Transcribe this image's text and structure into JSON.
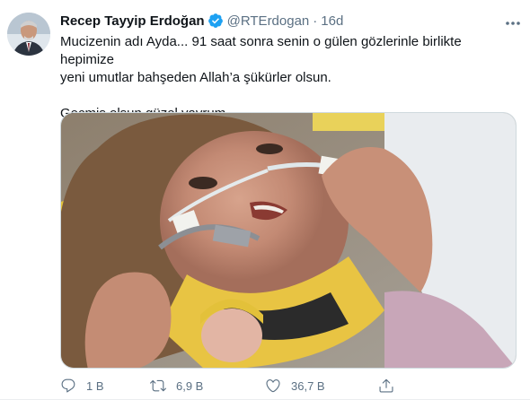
{
  "tweet": {
    "display_name": "Recep Tayyip Erdoğan",
    "handle": "@RTErdogan",
    "separator": "·",
    "time": "16d",
    "text_line1": "Mucizenin adı Ayda... 91 saat sonra senin o gülen gözlerinle birlikte hepimize",
    "text_line2": "yeni umutlar bahşeden Allah’a şükürler olsun.",
    "text_line3": "Geçmiş olsun güzel yavrum...",
    "icons": {
      "avatar": "profile-photo",
      "verified": "verified-badge-icon",
      "more": "more-options-icon",
      "reply": "reply-icon",
      "retweet": "retweet-icon",
      "like": "heart-icon",
      "share": "share-icon"
    },
    "colors": {
      "verified": "#1da1f2",
      "secondary_text": "#5b7083",
      "primary_text": "#0f1419"
    }
  },
  "actions": {
    "reply_count": "1 B",
    "retweet_count": "6,9 B",
    "like_count": "36,7 B"
  }
}
